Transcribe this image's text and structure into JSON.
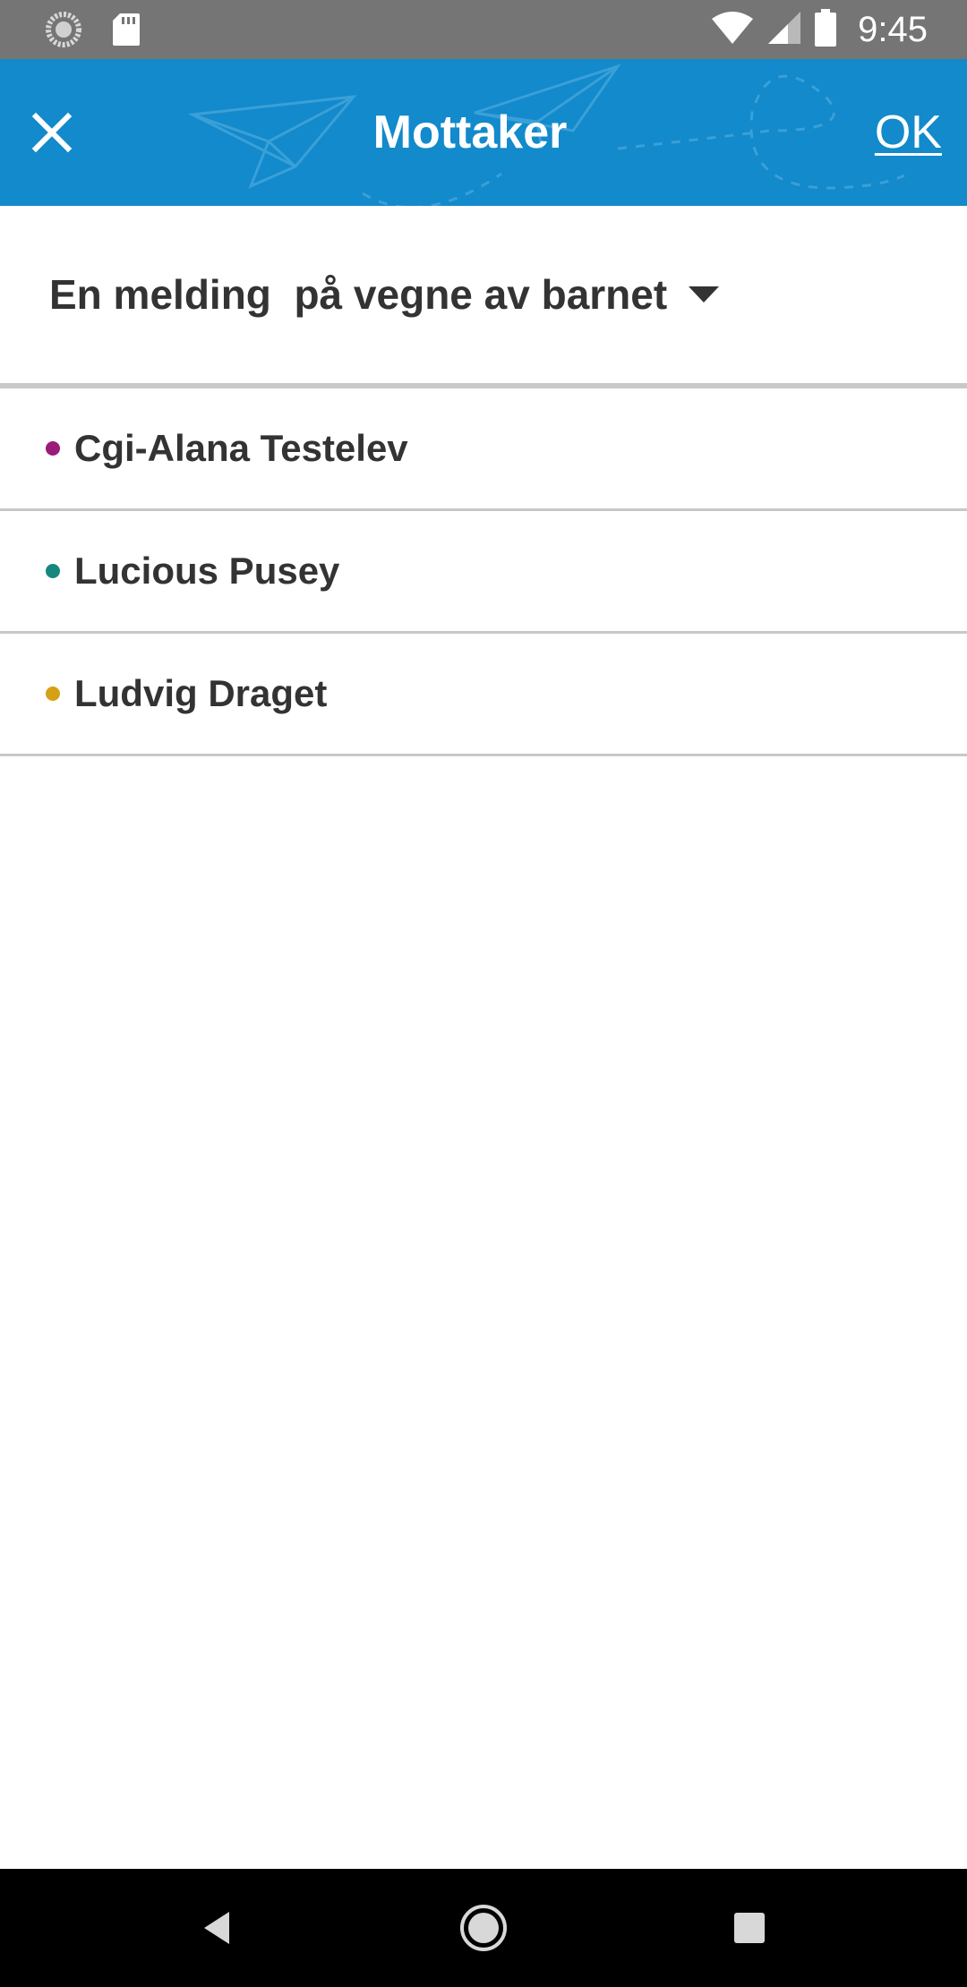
{
  "status_bar": {
    "time": "9:45",
    "icons": [
      "sync-icon",
      "sd-card-icon",
      "wifi-icon",
      "cellular-signal-icon",
      "battery-icon"
    ]
  },
  "app_bar": {
    "title": "Mottaker",
    "close_icon": "close-icon",
    "ok_label": "OK",
    "background_color": "#128acb"
  },
  "sender": {
    "label": "En melding  på vegne av barnet",
    "dropdown_icon": "dropdown-arrow-icon"
  },
  "recipients": [
    {
      "name": "Cgi-Alana Testelev",
      "color": "#9b1b78"
    },
    {
      "name": "Lucious Pusey",
      "color": "#17877e"
    },
    {
      "name": "Ludvig Draget",
      "color": "#d5a014"
    }
  ],
  "nav_bar": {
    "buttons": [
      "back-icon",
      "home-icon",
      "recents-icon"
    ]
  }
}
